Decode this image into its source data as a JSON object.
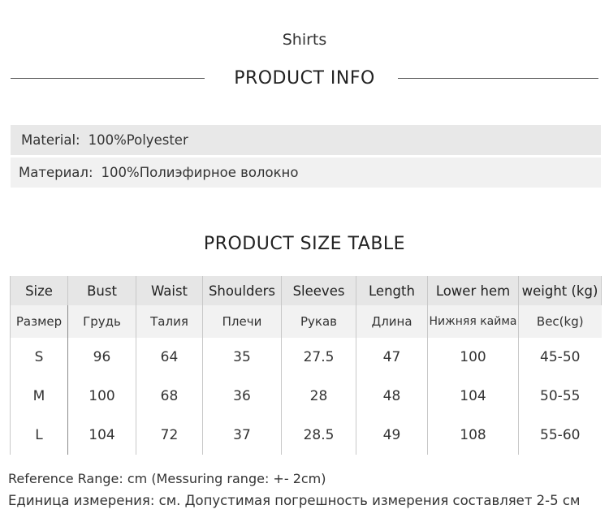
{
  "category": "Shirts",
  "product_info": {
    "heading": "PRODUCT INFO",
    "material_en": {
      "label": "Material:",
      "value": "100%Polyester"
    },
    "material_ru": {
      "label": "Материал:",
      "value": "100%Полиэфирное волокно"
    }
  },
  "size_table": {
    "heading": "PRODUCT SIZE TABLE",
    "headers_en": [
      "Size",
      "Bust",
      "Waist",
      "Shoulders",
      "Sleeves",
      "Length",
      "Lower hem",
      "weight (kg)"
    ],
    "headers_ru": [
      "Размер",
      "Грудь",
      "Талия",
      "Плечи",
      "Рукав",
      "Длина",
      "Нижняя кайма",
      "Вес(kg)"
    ],
    "rows": [
      [
        "S",
        "96",
        "64",
        "35",
        "27.5",
        "47",
        "100",
        "45-50"
      ],
      [
        "M",
        "100",
        "68",
        "36",
        "28",
        "48",
        "104",
        "50-55"
      ],
      [
        "L",
        "104",
        "72",
        "37",
        "28.5",
        "49",
        "108",
        "55-60"
      ]
    ]
  },
  "notes": {
    "en": "Reference Range: cm (Messuring range: +- 2cm)",
    "ru": "Единица измерения: см. Допустимая погрешность измерения составляет 2-5 см"
  }
}
